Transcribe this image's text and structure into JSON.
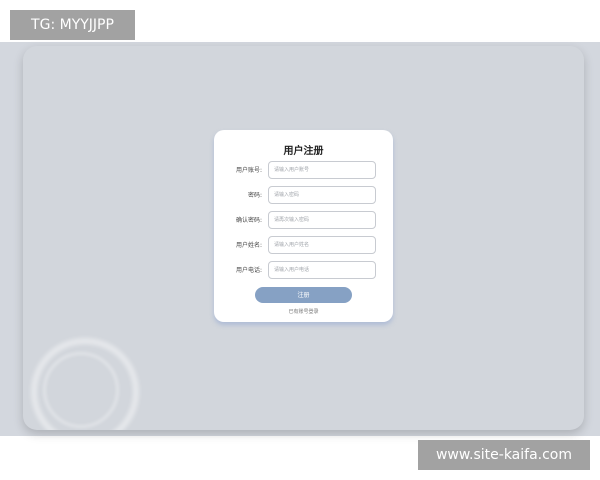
{
  "watermarks": {
    "top_left": "TG: MYYJJPP",
    "bottom_right": "www.site-kaifa.com"
  },
  "form": {
    "title": "用户注册",
    "fields": [
      {
        "label": "用户账号:",
        "placeholder": "请输入用户账号",
        "value": ""
      },
      {
        "label": "密码:",
        "placeholder": "请输入密码",
        "value": ""
      },
      {
        "label": "确认密码:",
        "placeholder": "请再次输入密码",
        "value": ""
      },
      {
        "label": "用户姓名:",
        "placeholder": "请输入用户姓名",
        "value": ""
      },
      {
        "label": "用户电话:",
        "placeholder": "请输入用户电话",
        "value": ""
      }
    ],
    "submit_label": "注册",
    "login_link": "已有账号登录"
  },
  "colors": {
    "background": "#d2d6dc",
    "card": "#ffffff",
    "button": "#86a1c4",
    "watermark_bg": "#a2a2a2"
  }
}
